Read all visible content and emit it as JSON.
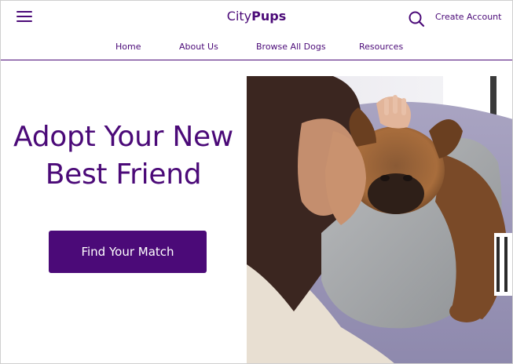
{
  "header": {
    "brand_part1": "City",
    "brand_part2": "Pups",
    "create_account_label": "Create Account",
    "menu_icon": "hamburger-menu-icon",
    "search_icon": "search-icon"
  },
  "nav": {
    "items": [
      {
        "label": "Home"
      },
      {
        "label": "About Us"
      },
      {
        "label": "Browse All Dogs"
      },
      {
        "label": "Resources"
      }
    ]
  },
  "hero": {
    "title_line1": "Adopt Your New",
    "title_line2": "Best Friend",
    "cta_label": "Find Your Match",
    "image_alt": "Woman hugging a French bulldog on a couch"
  },
  "colors": {
    "brand": "#4b0a78",
    "background": "#ffffff"
  }
}
